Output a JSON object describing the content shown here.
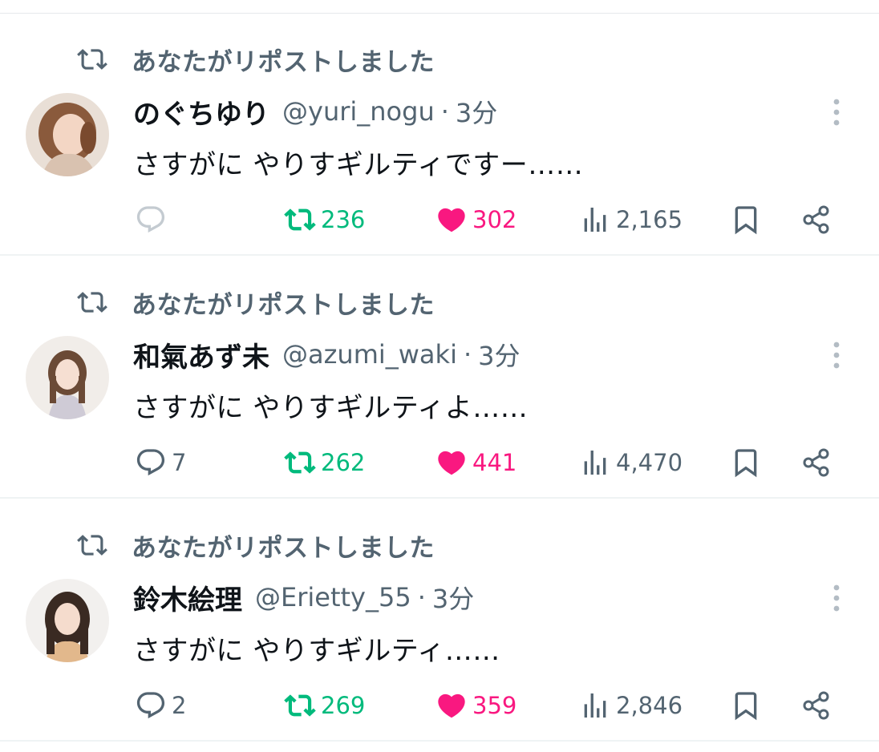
{
  "timeline": {
    "tweets": [
      {
        "social_context": "あなたがリポストしました",
        "display_name": "のぐちゆり",
        "handle": "@yuri_nogu",
        "separator": "·",
        "time": "3分",
        "text": "さすがに やりすギルティですー……",
        "replies": "",
        "reposts": "236",
        "likes": "302",
        "views": "2,165"
      },
      {
        "social_context": "あなたがリポストしました",
        "display_name": "和氣あず未",
        "handle": "@azumi_waki",
        "separator": "·",
        "time": "3分",
        "text": "さすがに やりすギルティよ……",
        "replies": "7",
        "reposts": "262",
        "likes": "441",
        "views": "4,470"
      },
      {
        "social_context": "あなたがリポストしました",
        "display_name": "鈴木絵理",
        "handle": "@Erietty_55",
        "separator": "·",
        "time": "3分",
        "text": "さすがに やりすギルティ……",
        "replies": "2",
        "reposts": "269",
        "likes": "359",
        "views": "2,846"
      }
    ]
  },
  "icons": {
    "social": "repost-icon",
    "more": "more-vertical-icon",
    "reply": "reply-icon",
    "repost": "repost-icon",
    "like": "heart-filled-icon",
    "views": "views-chart-icon",
    "bookmark": "bookmark-icon",
    "share": "share-icon"
  },
  "colors": {
    "text_primary": "#0f1419",
    "text_secondary": "#536471",
    "repost_active": "#00ba7c",
    "like_active": "#f91880",
    "divider": "#eff3f4"
  }
}
